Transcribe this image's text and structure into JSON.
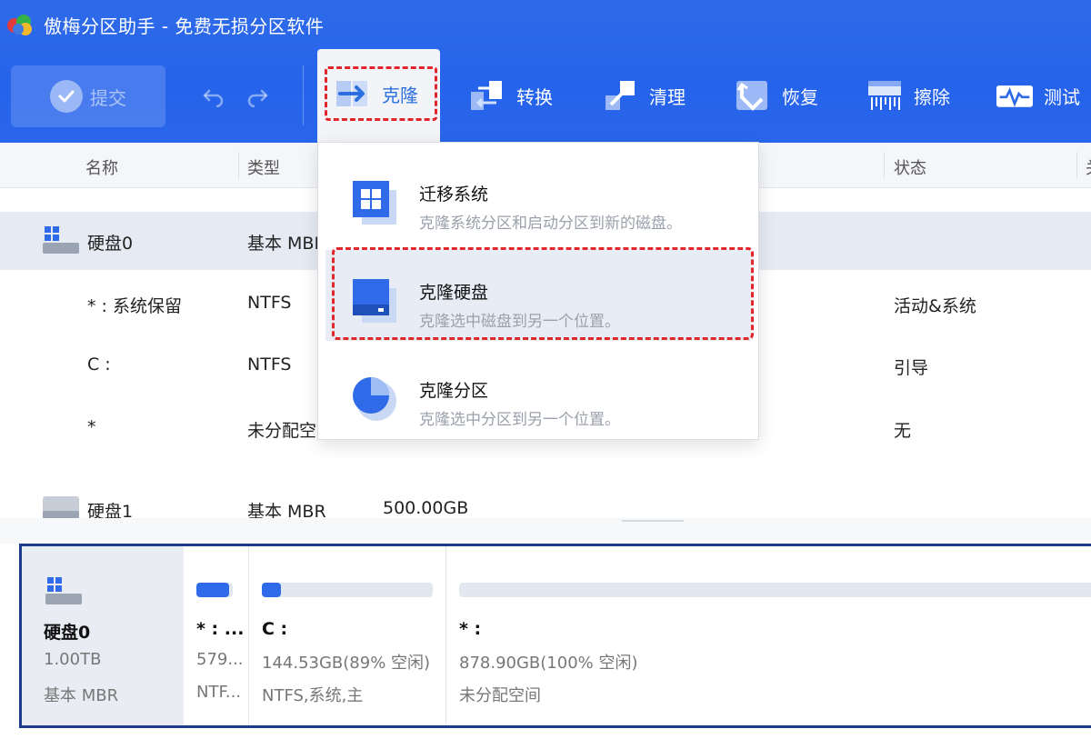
{
  "app": {
    "title": "傲梅分区助手 - 免费无损分区软件"
  },
  "toolbar": {
    "submit_label": "提交",
    "tools": [
      {
        "label": "克隆",
        "icon": "clone-arrow-icon"
      },
      {
        "label": "转换",
        "icon": "convert-icon"
      },
      {
        "label": "清理",
        "icon": "cleanup-icon"
      },
      {
        "label": "恢复",
        "icon": "recover-icon"
      },
      {
        "label": "擦除",
        "icon": "wipe-icon"
      },
      {
        "label": "测试",
        "icon": "test-icon"
      }
    ]
  },
  "columns": {
    "name": "名称",
    "type": "类型",
    "status": "状态",
    "extra": "关"
  },
  "rows": [
    {
      "name": "硬盘0",
      "type": "基本 MBR",
      "capacity": "",
      "status": ""
    },
    {
      "name": "* : 系统保留",
      "type": "NTFS",
      "capacity": "",
      "status": "活动&系统"
    },
    {
      "name": "C :",
      "type": "NTFS",
      "capacity": "",
      "status": "引导"
    },
    {
      "name": "*",
      "type": "未分配空间",
      "capacity": "",
      "status": "无"
    },
    {
      "name": "硬盘1",
      "type": "基本 MBR",
      "capacity": "500.00GB",
      "status": ""
    }
  ],
  "dropdown": {
    "items": [
      {
        "title": "迁移系统",
        "desc": "克隆系统分区和启动分区到新的磁盘。"
      },
      {
        "title": "克隆硬盘",
        "desc": "克隆选中磁盘到另一个位置。"
      },
      {
        "title": "克隆分区",
        "desc": "克隆选中分区到另一个位置。"
      }
    ]
  },
  "diskmap": {
    "disk": {
      "name": "硬盘0",
      "size": "1.00TB",
      "type": "基本 MBR"
    },
    "partitions": [
      {
        "name": "* : ...",
        "size": "579...",
        "fs": "NTF...",
        "used_fraction": 0.9
      },
      {
        "name": "C :",
        "size": "144.53GB(89% 空闲)",
        "fs": "NTFS,系统,主",
        "used_fraction": 0.11
      },
      {
        "name": "* :",
        "size": "878.90GB(100% 空闲)",
        "fs": "未分配空间",
        "used_fraction": 0.0
      }
    ]
  },
  "colors": {
    "header_blue": "#2563eb",
    "accent_blue": "#2f6be8",
    "highlight_red": "#e0262b",
    "selection": "#e6ebf3"
  }
}
